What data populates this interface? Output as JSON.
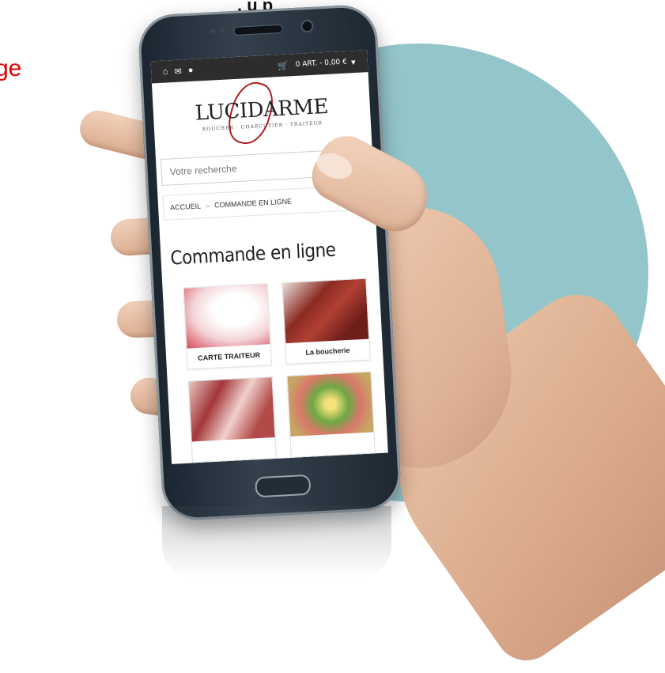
{
  "partial_texts": {
    "top_heading_fragment": ", u p",
    "left_red_fragment": "ge"
  },
  "topbar": {
    "icons": [
      "home-icon",
      "envelope-icon",
      "user-icon"
    ],
    "cart_icon": "cart-icon",
    "cart_text": "0 ART. - 0,00 €",
    "dropdown_icon": "caret-down-icon"
  },
  "logo": {
    "name": "LUCIDARME",
    "subtitle": "BOUCHER · CHARCUTIER · TRAITEUR"
  },
  "search": {
    "placeholder": "Votre recherche"
  },
  "menu_icon": "hamburger-icon",
  "breadcrumb": {
    "home": "ACCUEIL",
    "separator": "»",
    "current": "COMMANDE EN LIGNE"
  },
  "page_title": "Commande en ligne",
  "categories": [
    {
      "label": "CARTE TRAITEUR"
    },
    {
      "label": "La boucherie"
    },
    {
      "label": ""
    },
    {
      "label": ""
    }
  ],
  "colors": {
    "accent_red": "#e00000",
    "topbar": "#2d2d2d",
    "circle": "#93c5cb"
  }
}
